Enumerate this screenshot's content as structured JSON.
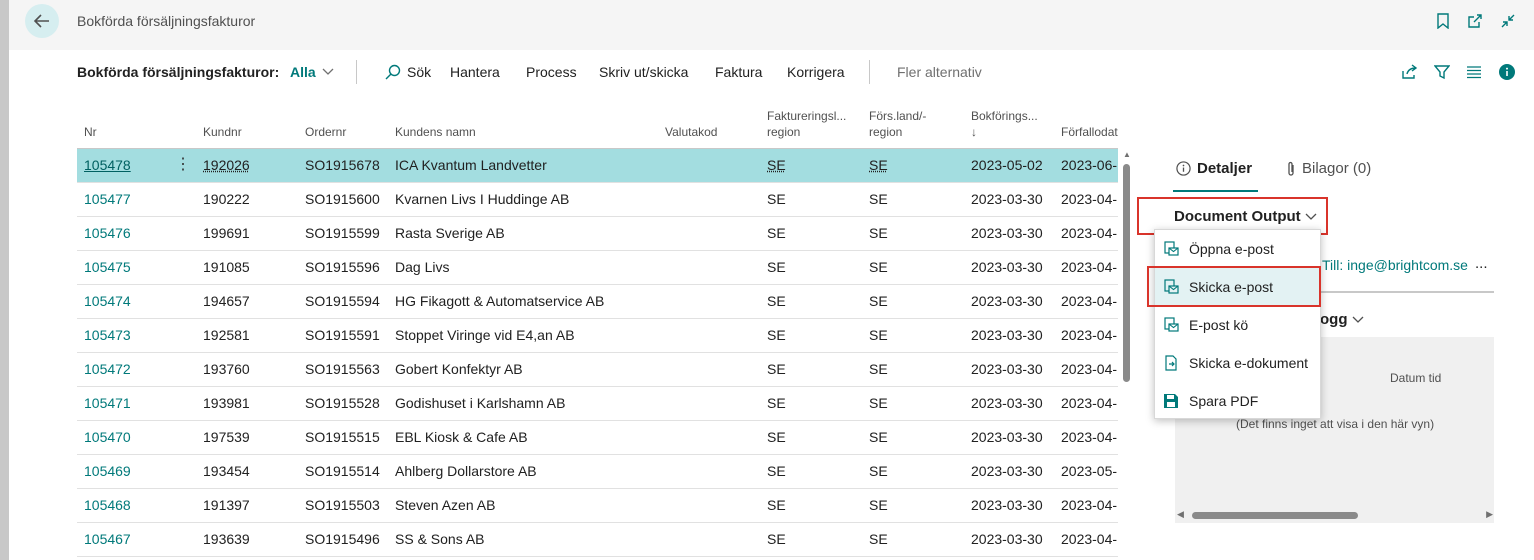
{
  "window": {
    "title": "Bokförda försäljningsfakturor"
  },
  "actionbar": {
    "title": "Bokförda försäljningsfakturor:",
    "filter": "Alla",
    "search": "Sök",
    "items": [
      "Hantera",
      "Process",
      "Skriv ut/skicka",
      "Faktura",
      "Korrigera"
    ],
    "more": "Fler alternativ"
  },
  "columns": {
    "nr": "Nr",
    "kundnr": "Kundnr",
    "ordernr": "Ordernr",
    "namn": "Kundens namn",
    "valuta": "Valutakod",
    "fakt_1": "Faktureringsl...",
    "fakt_2": "region",
    "fors_1": "Förs.land/-",
    "fors_2": "region",
    "bokf_1": "Bokförings...",
    "bokf_sort": "↓",
    "forfall": "Förfallodat..."
  },
  "rows": [
    {
      "nr": "105478",
      "kundnr": "192026",
      "ordernr": "SO1915678",
      "namn": "ICA Kvantum Landvetter",
      "valuta": "",
      "fakt": "SE",
      "fors": "SE",
      "bokf": "2023-05-02",
      "forfall": "2023-06-"
    },
    {
      "nr": "105477",
      "kundnr": "190222",
      "ordernr": "SO1915600",
      "namn": "Kvarnen Livs I Huddinge AB",
      "valuta": "",
      "fakt": "SE",
      "fors": "SE",
      "bokf": "2023-03-30",
      "forfall": "2023-04-"
    },
    {
      "nr": "105476",
      "kundnr": "199691",
      "ordernr": "SO1915599",
      "namn": "Rasta Sverige AB",
      "valuta": "",
      "fakt": "SE",
      "fors": "SE",
      "bokf": "2023-03-30",
      "forfall": "2023-04-"
    },
    {
      "nr": "105475",
      "kundnr": "191085",
      "ordernr": "SO1915596",
      "namn": "Dag Livs",
      "valuta": "",
      "fakt": "SE",
      "fors": "SE",
      "bokf": "2023-03-30",
      "forfall": "2023-04-"
    },
    {
      "nr": "105474",
      "kundnr": "194657",
      "ordernr": "SO1915594",
      "namn": "HG Fikagott & Automatservice AB",
      "valuta": "",
      "fakt": "SE",
      "fors": "SE",
      "bokf": "2023-03-30",
      "forfall": "2023-04-"
    },
    {
      "nr": "105473",
      "kundnr": "192581",
      "ordernr": "SO1915591",
      "namn": "Stoppet Viringe vid E4,an AB",
      "valuta": "",
      "fakt": "SE",
      "fors": "SE",
      "bokf": "2023-03-30",
      "forfall": "2023-04-"
    },
    {
      "nr": "105472",
      "kundnr": "193760",
      "ordernr": "SO1915563",
      "namn": "Gobert Konfektyr AB",
      "valuta": "",
      "fakt": "SE",
      "fors": "SE",
      "bokf": "2023-03-30",
      "forfall": "2023-04-"
    },
    {
      "nr": "105471",
      "kundnr": "193981",
      "ordernr": "SO1915528",
      "namn": "Godishuset i Karlshamn AB",
      "valuta": "",
      "fakt": "SE",
      "fors": "SE",
      "bokf": "2023-03-30",
      "forfall": "2023-04-"
    },
    {
      "nr": "105470",
      "kundnr": "197539",
      "ordernr": "SO1915515",
      "namn": "EBL Kiosk & Cafe AB",
      "valuta": "",
      "fakt": "SE",
      "fors": "SE",
      "bokf": "2023-03-30",
      "forfall": "2023-04-"
    },
    {
      "nr": "105469",
      "kundnr": "193454",
      "ordernr": "SO1915514",
      "namn": "Ahlberg Dollarstore AB",
      "valuta": "",
      "fakt": "SE",
      "fors": "SE",
      "bokf": "2023-03-30",
      "forfall": "2023-05-"
    },
    {
      "nr": "105468",
      "kundnr": "191397",
      "ordernr": "SO1915503",
      "namn": "Steven Azen AB",
      "valuta": "",
      "fakt": "SE",
      "fors": "SE",
      "bokf": "2023-03-30",
      "forfall": "2023-04-"
    },
    {
      "nr": "105467",
      "kundnr": "193639",
      "ordernr": "SO1915496",
      "namn": "SS & Sons AB",
      "valuta": "",
      "fakt": "SE",
      "fors": "SE",
      "bokf": "2023-03-30",
      "forfall": "2023-04-"
    }
  ],
  "factbox": {
    "tab_details": "Detaljer",
    "tab_attachments": "Bilagor (0)",
    "document_output": "Document Output",
    "to_line": "Till: inge@brightcom.se",
    "more": "...",
    "log_title_fragment": "ogg",
    "datum_tid": "Datum tid",
    "empty_message": "(Det finns inget att visa i den här vyn)"
  },
  "menu": {
    "items": [
      {
        "label": "Öppna e-post",
        "icon": "email-doc-icon"
      },
      {
        "label": "Skicka e-post",
        "icon": "email-doc-icon"
      },
      {
        "label": "E-post kö",
        "icon": "email-doc-icon"
      },
      {
        "label": "Skicka e-dokument",
        "icon": "send-doc-icon"
      },
      {
        "label": "Spara PDF",
        "icon": "save-icon"
      }
    ],
    "highlighted": "Skicka e-post"
  },
  "colors": {
    "accent": "#00797a",
    "selected_row": "#a3dde0",
    "highlight_border": "#d9342b"
  }
}
